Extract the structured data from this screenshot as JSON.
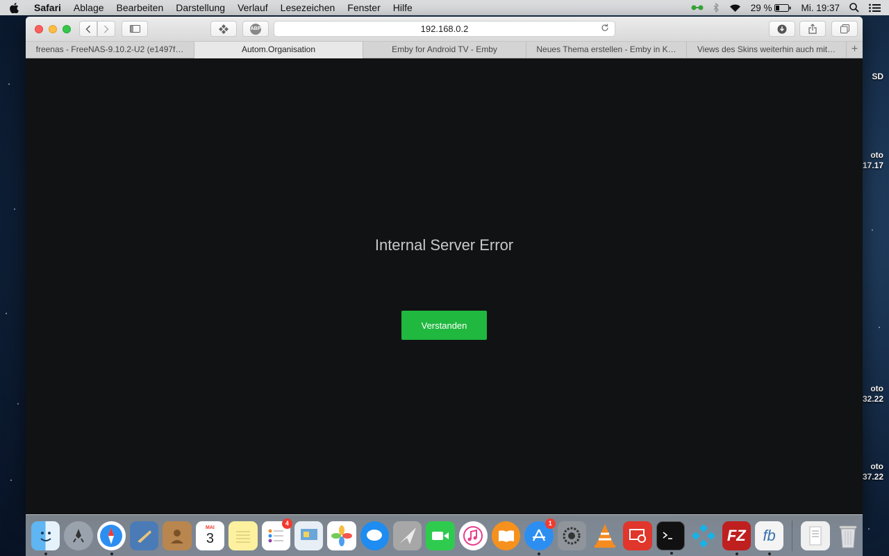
{
  "menubar": {
    "app": "Safari",
    "items": [
      "Ablage",
      "Bearbeiten",
      "Darstellung",
      "Verlauf",
      "Lesezeichen",
      "Fenster",
      "Hilfe"
    ],
    "battery": "29 %",
    "clock": "Mi. 19:37"
  },
  "desktop_labels": [
    {
      "text": "SD"
    },
    {
      "text": "oto\n17.17"
    },
    {
      "text": "oto\n32.22"
    },
    {
      "text": "oto\n37.22"
    }
  ],
  "browser": {
    "url": "192.168.0.2",
    "abp_label": "ABP",
    "tabs": [
      {
        "label": "freenas - FreeNAS-9.10.2-U2 (e1497f…",
        "active": false
      },
      {
        "label": "Autom.Organisation",
        "active": true
      },
      {
        "label": "Emby for Android TV - Emby",
        "active": false
      },
      {
        "label": "Neues Thema erstellen - Emby in K…",
        "active": false
      },
      {
        "label": "Views des Skins weiterhin auch mit…",
        "active": false
      }
    ],
    "new_tab": "+"
  },
  "page": {
    "error_title": "Internal Server Error",
    "confirm_button": "Verstanden"
  },
  "dock": {
    "calendar_month": "MAI",
    "calendar_day": "3",
    "reminders_badge": "4",
    "appstore_badge": "1",
    "filezilla_label": "FZ",
    "fb_label": "fb"
  },
  "colors": {
    "page_bg": "#111214",
    "accent_button": "#20b83f",
    "error_text": "#c8c8c8"
  }
}
